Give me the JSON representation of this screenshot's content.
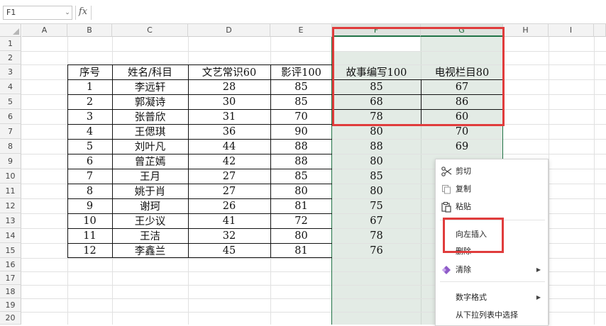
{
  "formula_bar": {
    "name_box": "F1",
    "fx_label": "fx",
    "formula": ""
  },
  "columns": [
    "A",
    "B",
    "C",
    "D",
    "E",
    "F",
    "G",
    "H",
    "I"
  ],
  "rows": [
    "1",
    "2",
    "3",
    "4",
    "5",
    "6",
    "7",
    "8",
    "9",
    "10",
    "11",
    "12",
    "13",
    "14",
    "15",
    "16",
    "17",
    "18",
    "19",
    "20"
  ],
  "table": {
    "headers": [
      "序号",
      "姓名/科目",
      "文艺常识60",
      "影评100",
      "故事编写100",
      "电视栏目80"
    ],
    "rows": [
      [
        "1",
        "李远轩",
        "28",
        "85",
        "85",
        "67"
      ],
      [
        "2",
        "郭凝诗",
        "30",
        "85",
        "68",
        "86"
      ],
      [
        "3",
        "张普欣",
        "31",
        "70",
        "78",
        "60"
      ],
      [
        "4",
        "王偲琪",
        "36",
        "90",
        "80",
        "70"
      ],
      [
        "5",
        "刘叶凡",
        "44",
        "88",
        "88",
        "69"
      ],
      [
        "6",
        "曾芷嫣",
        "42",
        "88",
        "80",
        ""
      ],
      [
        "7",
        "王月",
        "27",
        "85",
        "85",
        ""
      ],
      [
        "8",
        "姚于肖",
        "27",
        "80",
        "80",
        ""
      ],
      [
        "9",
        "谢珂",
        "26",
        "81",
        "75",
        ""
      ],
      [
        "10",
        "王少议",
        "41",
        "72",
        "67",
        ""
      ],
      [
        "11",
        "王洁",
        "32",
        "80",
        "78",
        ""
      ],
      [
        "12",
        "李鑫兰",
        "45",
        "81",
        "76",
        ""
      ]
    ]
  },
  "context_menu": {
    "items": [
      {
        "label": "剪切",
        "icon": "scissors-icon"
      },
      {
        "label": "复制",
        "icon": "copy-icon"
      },
      {
        "label": "粘贴",
        "icon": "paste-icon"
      },
      {
        "label": "向左插入"
      },
      {
        "label": "删除"
      },
      {
        "label": "清除",
        "icon": "eraser-icon",
        "submenu": true
      },
      {
        "label": "数字格式",
        "submenu": true
      },
      {
        "label": "从下拉列表中选择"
      }
    ],
    "submenu_arrow": "▶"
  },
  "colors": {
    "selection_fill": "#e3ebe5",
    "selection_border": "#217346",
    "highlight": "#e03c3c",
    "header_bg": "#f3f3f3"
  }
}
